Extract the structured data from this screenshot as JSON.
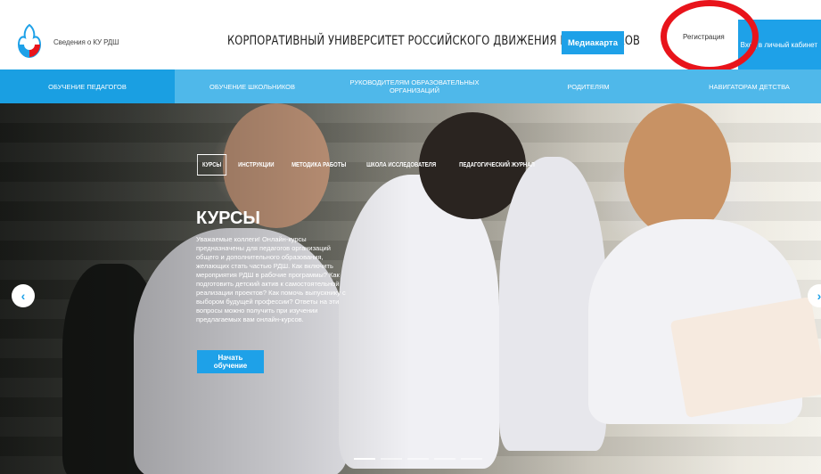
{
  "header": {
    "about_link": "Сведения о КУ РДШ",
    "site_title": "КОРПОРАТИВНЫЙ УНИВЕРСИТЕТ РОССИЙСКОГО ДВИЖЕНИЯ ШКОЛЬНИКОВ",
    "media_button": "Медиакарта",
    "register_link": "Регистрация",
    "cabinet_button": "Вход в личный кабинет"
  },
  "nav": {
    "items": [
      {
        "label": "ОБУЧЕНИЕ ПЕДАГОГОВ"
      },
      {
        "label": "ОБУЧЕНИЕ ШКОЛЬНИКОВ"
      },
      {
        "label": "РУКОВОДИТЕЛЯМ ОБРАЗОВАТЕЛЬНЫХ ОРГАНИЗАЦИЙ"
      },
      {
        "label": "РОДИТЕЛЯМ"
      },
      {
        "label": "НАВИГАТОРАМ ДЕТСТВА"
      }
    ]
  },
  "hero": {
    "tabs": [
      {
        "label": "КУРСЫ"
      },
      {
        "label": "ИНСТРУКЦИИ"
      },
      {
        "label": "МЕТОДИКА РАБОТЫ"
      },
      {
        "label": "ШКОЛА ИССЛЕДОВАТЕЛЯ"
      },
      {
        "label": "ПЕДАГОГИЧЕСКИЙ ЖУРНАЛ"
      }
    ],
    "title": "КУРСЫ",
    "text": "Уважаемые коллеги! Онлайн-курсы предназначены для педагогов организаций общего и дополнительного образования, желающих стать частью РДШ. Как включить мероприятия РДШ в рабочие программы? Как подготовить детский актив к самостоятельной реализации проектов? Как помочь выпускнику с выбором будущей профессии? Ответы на эти вопросы можно получить при изучении предлагаемых вам онлайн-курсов.",
    "button": "Начать\nобучение",
    "prev_icon": "‹",
    "next_icon": "›"
  },
  "colors": {
    "accent": "#1ea1e8",
    "nav_bg": "#4fb8ea",
    "annotation": "#e8141b"
  }
}
